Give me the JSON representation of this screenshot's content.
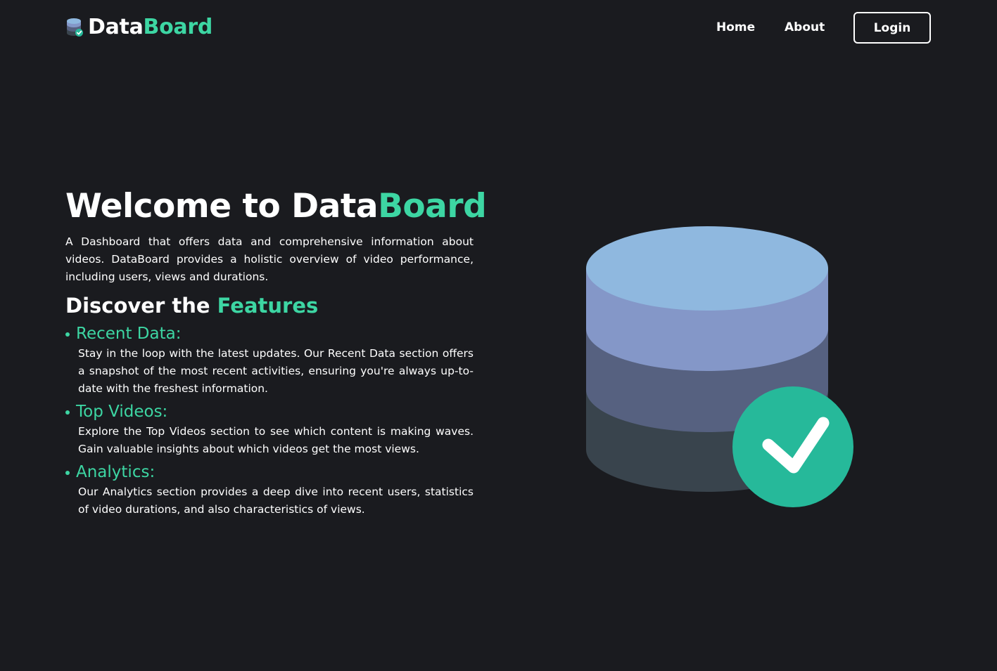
{
  "navbar": {
    "brand_part1": "Data",
    "brand_part2": "Board",
    "home_label": "Home",
    "about_label": "About",
    "login_label": "Login"
  },
  "hero": {
    "title_part1": "Welcome to Data",
    "title_part2": "Board",
    "description": "A Dashboard that offers data and comprehensive information about videos. DataBoard provides a holistic overview of video performance, including users, views and durations."
  },
  "features": {
    "title_part1": "Discover the ",
    "title_part2": "Features",
    "items": [
      {
        "title": "Recent Data:",
        "description": "Stay in the loop with the latest updates. Our Recent Data section offers a snapshot of the most recent activities, ensuring you're always up-to-date with the freshest information."
      },
      {
        "title": "Top Videos:",
        "description": "Explore the Top Videos section to see which content is making waves. Gain valuable insights about which videos get the most views."
      },
      {
        "title": "Analytics:",
        "description": "Our Analytics section provides a deep dive into recent users, statistics of video durations, and also characteristics of views."
      }
    ]
  },
  "colors": {
    "background": "#1a1b1f",
    "accent": "#3dd6a3",
    "db_top": "#8fb8df",
    "db_layer1": "#8497c8",
    "db_layer2": "#566180",
    "db_layer3": "#39444d",
    "check_circle": "#26b99a"
  },
  "icons": {
    "brand_logo": "database-check-icon",
    "illustration": "database-check-icon"
  }
}
